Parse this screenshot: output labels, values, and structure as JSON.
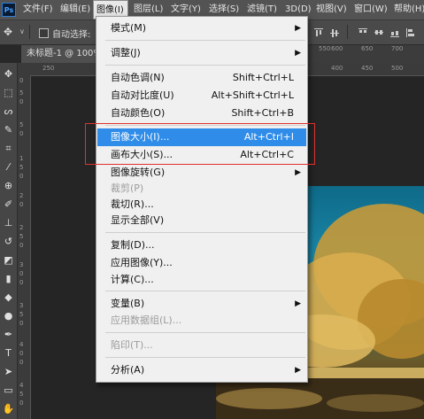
{
  "app": {
    "logo_text": "Ps"
  },
  "menubar": {
    "items": [
      {
        "label": "文件(F)"
      },
      {
        "label": "编辑(E)"
      },
      {
        "label": "图像(I)"
      },
      {
        "label": "图层(L)"
      },
      {
        "label": "文字(Y)"
      },
      {
        "label": "选择(S)"
      },
      {
        "label": "滤镜(T)"
      },
      {
        "label": "3D(D)"
      },
      {
        "label": "视图(V)"
      },
      {
        "label": "窗口(W)"
      },
      {
        "label": "帮助(H)"
      }
    ]
  },
  "options_bar": {
    "auto_select_label": "自动选择:"
  },
  "document_tab": {
    "title": "未标题-1 @ 100%"
  },
  "ruler": {
    "top": [
      "250",
      "1",
      "400",
      "450",
      "500",
      "550",
      "600",
      "650",
      "700"
    ],
    "left": [
      "0",
      "5",
      "0",
      "5",
      "0",
      "1",
      "5",
      "0",
      "2",
      "0",
      "2",
      "5",
      "0",
      "3",
      "0",
      "0",
      "3",
      "5",
      "0",
      "4",
      "0",
      "0",
      "4",
      "5",
      "0"
    ]
  },
  "image_menu": {
    "items": [
      {
        "label": "模式(M)",
        "shortcut": "",
        "submenu": true
      },
      {
        "label": "调整(J)",
        "shortcut": "",
        "submenu": true
      },
      {
        "label": "自动色调(N)",
        "shortcut": "Shift+Ctrl+L"
      },
      {
        "label": "自动对比度(U)",
        "shortcut": "Alt+Shift+Ctrl+L"
      },
      {
        "label": "自动颜色(O)",
        "shortcut": "Shift+Ctrl+B"
      },
      {
        "label": "图像大小(I)...",
        "shortcut": "Alt+Ctrl+I",
        "highlighted": true
      },
      {
        "label": "画布大小(S)...",
        "shortcut": "Alt+Ctrl+C"
      },
      {
        "label": "图像旋转(G)",
        "shortcut": "",
        "submenu": true
      },
      {
        "label": "裁剪(P)",
        "shortcut": "",
        "disabled": true
      },
      {
        "label": "裁切(R)...",
        "shortcut": ""
      },
      {
        "label": "显示全部(V)",
        "shortcut": ""
      },
      {
        "label": "复制(D)...",
        "shortcut": ""
      },
      {
        "label": "应用图像(Y)...",
        "shortcut": ""
      },
      {
        "label": "计算(C)...",
        "shortcut": ""
      },
      {
        "label": "变量(B)",
        "shortcut": "",
        "submenu": true
      },
      {
        "label": "应用数据组(L)...",
        "shortcut": "",
        "disabled": true
      },
      {
        "label": "陷印(T)...",
        "shortcut": "",
        "disabled": true
      },
      {
        "label": "分析(A)",
        "shortcut": "",
        "submenu": true
      }
    ]
  },
  "colors": {
    "highlight": "#2f8ce8",
    "annotation_box": "#e03030",
    "menu_bg": "#f0f0f0"
  }
}
